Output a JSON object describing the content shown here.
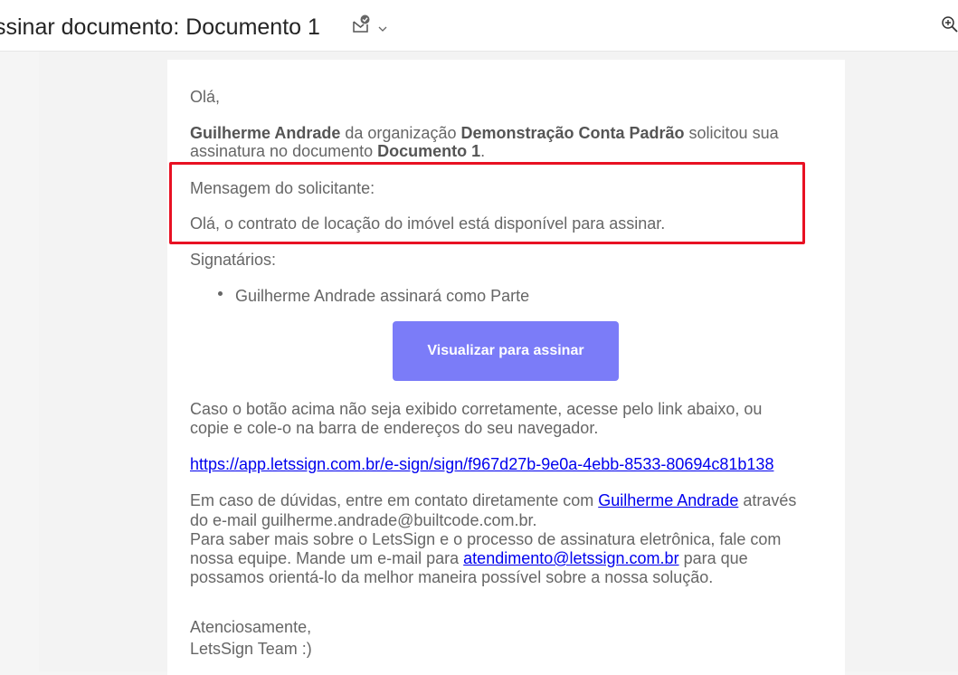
{
  "header": {
    "subject": "ssinar documento: Documento 1",
    "subject_icon": "mail-check-icon",
    "chevron_icon": "chevron-down-icon",
    "zoom_icon": "zoom-in-icon"
  },
  "email": {
    "greeting": "Olá,",
    "intro": {
      "sender": "Guilherme Andrade",
      "t1": " da organização ",
      "org": "Demonstração Conta Padrão",
      "t2": " solicitou sua",
      "t3": "assinatura no documento ",
      "doc": "Documento 1",
      "t4": "."
    },
    "message_label": "Mensagem do solicitante:",
    "message_text": "Olá, o contrato de locação do imóvel está disponível para assinar.",
    "signers_label": "Signatários:",
    "signers": [
      "Guilherme Andrade assinará como Parte"
    ],
    "button_label": "Visualizar para assinar",
    "fallback_line1": "Caso o botão acima não seja exibido corretamente, acesse pelo link abaixo, ou",
    "fallback_line2": "copie e cole-o na barra de endereços do seu navegador.",
    "sign_link": "https://app.letssign.com.br/e-sign/sign/f967d27b-9e0a-4ebb-8533-80694c81b138",
    "contact": {
      "l1_a": "Em caso de dúvidas, entre em contato diretamente com ",
      "l1_link": "Guilherme Andrade",
      "l1_b": " através",
      "l2": "do e-mail guilherme.andrade@builtcode.com.br.",
      "l3": "Para saber mais sobre o LetsSign e o processo de assinatura eletrônica, fale com",
      "l4_a": "nossa equipe. Mande um e-mail para ",
      "l4_link": "atendimento@letssign.com.br",
      "l4_b": " para que",
      "l5": "possamos orientá-lo da melhor maneira possível sobre a nossa solução."
    },
    "closing": "Atenciosamente,",
    "signature": "LetsSign Team :)"
  },
  "colors": {
    "highlight_border": "#e81123",
    "button_bg": "#7b7cf8",
    "link": "#0000ee"
  }
}
